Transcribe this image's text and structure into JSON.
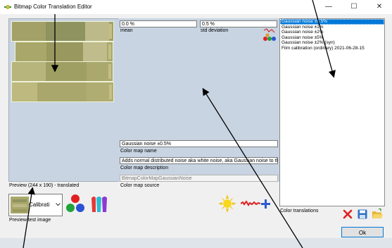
{
  "window": {
    "title": "Bitmap Color Translation Editor",
    "minimize": "—",
    "maximize": "☐",
    "close": "✕"
  },
  "preview": {
    "caption": "Preview (244 x 190) - translated",
    "test_image_label": "Preview test image",
    "dropdown_value": "Calibrati"
  },
  "stats": {
    "mean_value": "0.0 %",
    "mean_label": "mean",
    "std_value": "0.5 %",
    "std_label": "std deviation"
  },
  "colormap": {
    "name_value": "Gaussian noise ±0.5%",
    "name_label": "Color map name",
    "description_value": "Adds normal distributed noise aka white noise, aka Gaussian noise to the ima",
    "description_label": "Color map description",
    "source_value": "BitmapColorMapGaussianNoise",
    "source_label": "Color map source"
  },
  "translations": {
    "label": "Color translations",
    "items": [
      "Gaussian noise ±0.5%",
      "Gaussian noise ±1%",
      "Gaussian noise ±2%",
      "Gaussian noise ±5%",
      "Gaussian noise ±2% (syn)",
      "Film calibration (ordinary) 2021-06-28-15"
    ]
  },
  "ok_label": "Ok",
  "colors": {
    "accent": "#0078d7",
    "panel": "#c8d4e2",
    "film": "#a9a86a"
  }
}
